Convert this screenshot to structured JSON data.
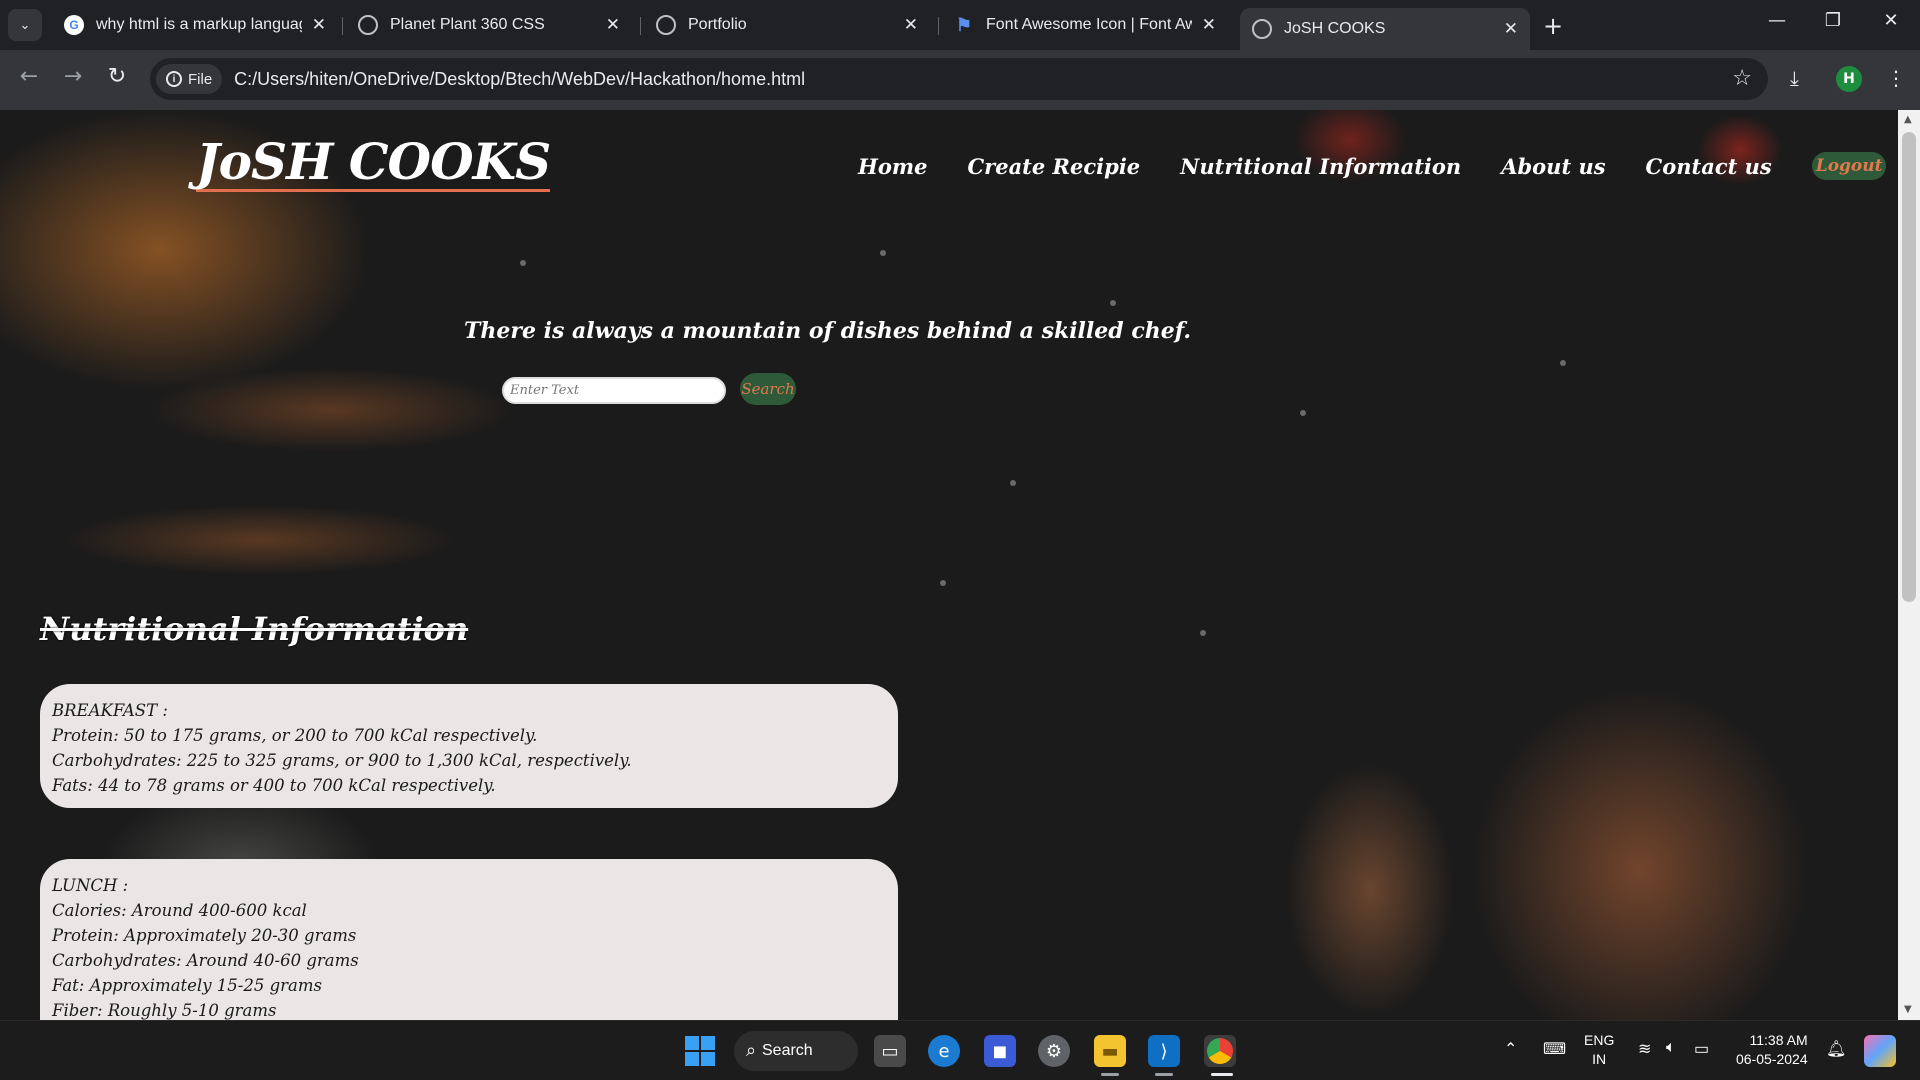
{
  "browser": {
    "tabs": [
      {
        "title": "why html is a markup language",
        "favicon": "google-icon",
        "active": false
      },
      {
        "title": "Planet Plant 360 CSS",
        "favicon": "globe-icon",
        "active": false
      },
      {
        "title": "Portfolio",
        "favicon": "globe-icon",
        "active": false
      },
      {
        "title": "Font Awesome Icon | Font Awesome",
        "favicon": "flag-icon",
        "active": false
      },
      {
        "title": "JoSH COOKS",
        "favicon": "globe-icon",
        "active": true
      }
    ],
    "new_tab": "+",
    "address_chip": "File",
    "url": "C:/Users/hiten/OneDrive/Desktop/Btech/WebDev/Hackathon/home.html",
    "profile_initial": "H"
  },
  "site": {
    "logo": "JoSH COOKS",
    "nav": {
      "home": "Home",
      "create_recipe": "Create Recipie",
      "nutrition": "Nutritional Information",
      "about": "About us",
      "contact": "Contact us",
      "logout": "Logout"
    },
    "tagline": "There is always a mountain of dishes behind a skilled chef.",
    "search": {
      "placeholder": "Enter Text",
      "button": "Search"
    },
    "section_title": "Nutritional Information",
    "cards": [
      {
        "lines": [
          "BREAKFAST :",
          "Protein: 50 to 175 grams, or 200 to 700 kCal respectively.",
          "Carbohydrates: 225 to 325 grams, or 900 to 1,300 kCal, respectively.",
          "Fats: 44 to 78 grams or 400 to 700 kCal respectively."
        ]
      },
      {
        "lines": [
          "LUNCH :",
          "Calories: Around 400-600 kcal",
          "Protein: Approximately 20-30 grams",
          "Carbohydrates: Around 40-60 grams",
          "Fat: Approximately 15-25 grams",
          "Fiber: Roughly 5-10 grams"
        ]
      }
    ]
  },
  "taskbar": {
    "search_label": "Search",
    "lang_line1": "ENG",
    "lang_line2": "IN",
    "time": "11:38 AM",
    "date": "06-05-2024",
    "accent": "#3aa0f3"
  }
}
